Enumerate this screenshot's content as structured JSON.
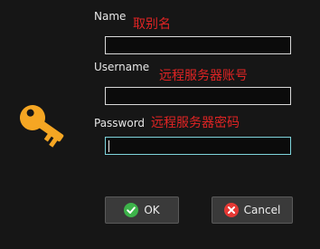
{
  "form": {
    "name_label": "Name",
    "name_annotation": "取别名",
    "name_value": "",
    "username_label": "Username",
    "username_annotation": "远程服务器账号",
    "username_value": "",
    "password_label": "Password",
    "password_annotation": "远程服务器密码",
    "password_value": ""
  },
  "buttons": {
    "ok_label": "OK",
    "cancel_label": "Cancel"
  },
  "icons": {
    "key": "key-icon",
    "ok": "check-circle-icon",
    "cancel": "x-circle-icon"
  },
  "colors": {
    "background": "#161616",
    "annotation": "#e02424",
    "key": "#f5a623",
    "ok_icon": "#3db34a",
    "cancel_icon": "#e53935",
    "focus_border": "#7fd4dc"
  }
}
